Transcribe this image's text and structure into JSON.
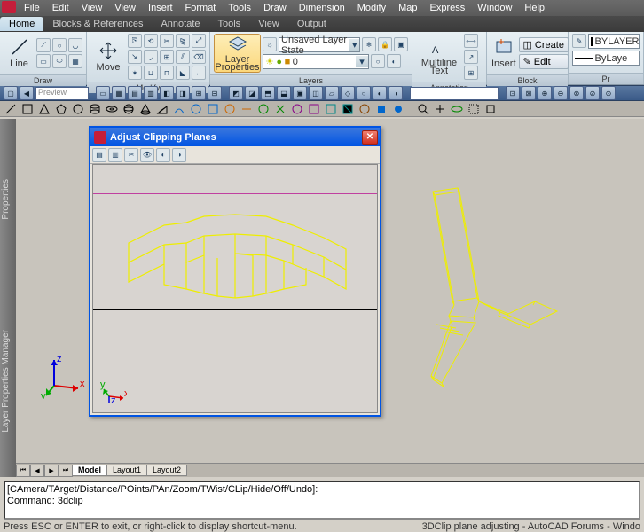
{
  "menu": [
    "File",
    "Edit",
    "View",
    "View",
    "Insert",
    "Format",
    "Tools",
    "Draw",
    "Dimension",
    "Modify",
    "Map",
    "Express",
    "Window",
    "Help"
  ],
  "tabs": [
    "Home",
    "Blocks & References",
    "Annotate",
    "Tools",
    "View",
    "Output"
  ],
  "active_tab": "Home",
  "ribbon": {
    "draw": {
      "title": "Draw",
      "line_label": "Line"
    },
    "modify": {
      "title": "Modify",
      "move_label": "Move"
    },
    "layers": {
      "title": "Layers",
      "btn_label": "Layer Properties",
      "state": "Unsaved Layer State",
      "current": "0"
    },
    "annotation": {
      "title": "Annotation",
      "mtext_label": "Multiline Text"
    },
    "block": {
      "title": "Block",
      "insert_label": "Insert",
      "create_label": "Create",
      "edit_label": "Edit"
    },
    "properties": {
      "title": "Pr",
      "bylayer": "BYLAYER",
      "byline": "ByLaye"
    }
  },
  "qtoolbar": {
    "preview": "Preview"
  },
  "layout_tabs": [
    "Model",
    "Layout1",
    "Layout2"
  ],
  "active_layout": "Model",
  "command": {
    "line1": "[CAmera/TArget/Distance/POints/PAn/Zoom/TWist/CLip/Hide/Off/Undo]:",
    "line2": "Command: 3dclip"
  },
  "status": {
    "left": "Press ESC or ENTER to exit, or right-click to display shortcut-menu.",
    "right": "3DClip plane adjusting - AutoCAD Forums - Windo"
  },
  "dialog": {
    "title": "Adjust Clipping Planes"
  },
  "ucs_labels": {
    "x": "x",
    "y": "y",
    "z": "z"
  }
}
